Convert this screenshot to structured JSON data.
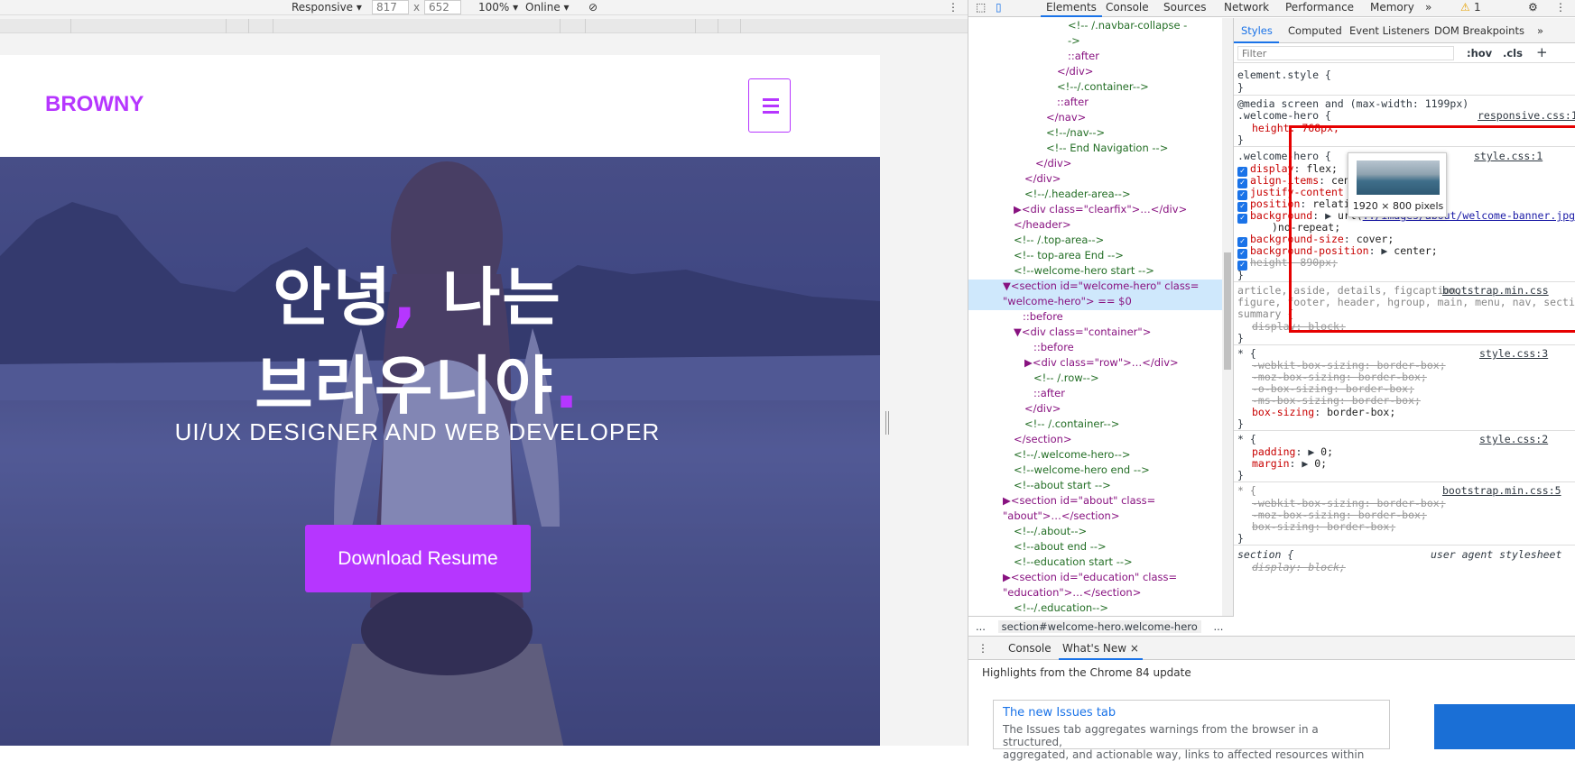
{
  "device_toolbar": {
    "device": "Responsive",
    "width": "817",
    "times": "x",
    "height": "652",
    "zoom": "100%",
    "network": "Online"
  },
  "site": {
    "brand": "BROWNY",
    "hero_line1_a": "안녕",
    "hero_line1_comma": ",",
    "hero_line1_b": " 나는",
    "hero_line2_a": "브라우니야",
    "hero_line2_dot": ".",
    "subtitle": "UI/UX DESIGNER AND WEB DEVELOPER",
    "button": "Download Resume",
    "accent_color": "#b636ff"
  },
  "devtools": {
    "tabs": [
      "Elements",
      "Console",
      "Sources",
      "Network",
      "Performance",
      "Memory"
    ],
    "more_tabs": "»",
    "warning_count": "1",
    "elements_lines": [
      {
        "t": "<!-- /.navbar-collapse -",
        "cls": "cm"
      },
      {
        "t": "->",
        "cls": "cm"
      },
      {
        "t": "::after",
        "cls": "ps"
      },
      {
        "t": "</div>",
        "cls": "tg"
      },
      {
        "t": "<!--/.container-->",
        "cls": "cm"
      },
      {
        "t": "::after",
        "cls": "ps"
      },
      {
        "t": "</nav>",
        "cls": "tg"
      },
      {
        "t": "<!--/nav-->",
        "cls": "cm"
      },
      {
        "t": "<!-- End Navigation -->",
        "cls": "cm"
      },
      {
        "t": "</div>",
        "cls": "tg"
      },
      {
        "t": "</div>",
        "cls": "tg"
      },
      {
        "t": "<!--/.header-area-->",
        "cls": "cm"
      },
      {
        "t": "▶<div class=\"clearfix\">…</div>",
        "cls": "tg"
      },
      {
        "t": "</header>",
        "cls": "tg"
      },
      {
        "t": "<!-- /.top-area-->",
        "cls": "cm"
      },
      {
        "t": "<!-- top-area End -->",
        "cls": "cm"
      },
      {
        "t": "<!--welcome-hero start -->",
        "cls": "cm"
      },
      {
        "t": "▼<section id=\"welcome-hero\" class=",
        "cls": "tg"
      },
      {
        "t": "\"welcome-hero\"> == $0",
        "cls": "tg"
      },
      {
        "t": "::before",
        "cls": "ps"
      },
      {
        "t": "▼<div class=\"container\">",
        "cls": "tg"
      },
      {
        "t": "::before",
        "cls": "ps"
      },
      {
        "t": "▶<div class=\"row\">…</div>",
        "cls": "tg"
      },
      {
        "t": "<!-- /.row-->",
        "cls": "cm"
      },
      {
        "t": "::after",
        "cls": "ps"
      },
      {
        "t": "</div>",
        "cls": "tg"
      },
      {
        "t": "<!-- /.container-->",
        "cls": "cm"
      },
      {
        "t": "</section>",
        "cls": "tg"
      },
      {
        "t": "<!--/.welcome-hero-->",
        "cls": "cm"
      },
      {
        "t": "<!--welcome-hero end -->",
        "cls": "cm"
      },
      {
        "t": "<!--about start -->",
        "cls": "cm"
      },
      {
        "t": "▶<section id=\"about\" class=",
        "cls": "tg"
      },
      {
        "t": "\"about\">…</section>",
        "cls": "tg"
      },
      {
        "t": "<!--/.about-->",
        "cls": "cm"
      },
      {
        "t": "<!--about end -->",
        "cls": "cm"
      },
      {
        "t": "<!--education start -->",
        "cls": "cm"
      },
      {
        "t": "▶<section id=\"education\" class=",
        "cls": "tg"
      },
      {
        "t": "\"education\">…</section>",
        "cls": "tg"
      },
      {
        "t": "<!--/.education-->",
        "cls": "cm"
      }
    ],
    "breadcrumb": "section#welcome-hero.welcome-hero",
    "breadcrumb_dots": "...",
    "styles_tabs": [
      "Styles",
      "Computed",
      "Event Listeners",
      "DOM Breakpoints"
    ],
    "filter_placeholder": "Filter",
    "hov": ":hov",
    "cls": ".cls",
    "plus": "+",
    "rules": {
      "element_style": "element.style {",
      "media": "@media screen and (max-width: 1199px)",
      "media_sel": ".welcome-hero {",
      "media_src": "responsive.css:1",
      "media_height": "height: 768px;",
      "main_sel": ".welcome-hero {",
      "main_src": "style.css:1",
      "p_display": "display",
      "v_display": "flex;",
      "p_align": "align-items",
      "v_align": "cen",
      "p_justify": "justify-content",
      "p_position": "position",
      "v_position": "relative;",
      "p_background": "background",
      "v_background_a": "url(",
      "v_background_link": "../images/about/welcome-banner.jpg",
      "v_background_b": ")no-repeat;",
      "p_bgsize": "background-size",
      "v_bgsize": "cover;",
      "p_bgpos": "background-position",
      "v_bgpos": "center;",
      "p_height": "height",
      "v_height": "890px;",
      "article_sel": "article, aside, details, figcaption,",
      "article_sel2": "figure, footer, header, hgroup, main, menu, nav, section,",
      "article_src": "bootstrap.min.css",
      "summary_sel": "summary {",
      "summary_prop": "display: block;",
      "star1_src": "style.css:3",
      "webkit_bs": "-webkit-box-sizing: border-box;",
      "moz_bs": "-moz-box-sizing: border-box;",
      "o_bs": "-o-box-sizing: border-box;",
      "ms_bs": "-ms-box-sizing: border-box;",
      "bs_prop": "box-sizing",
      "bs_val": "border-box;",
      "star2_src": "style.css:2",
      "padding_prop": "padding",
      "padding_val": "0;",
      "margin_prop": "margin",
      "margin_val": "0;",
      "star3_src": "bootstrap.min.css:5",
      "bs_strike": "box-sizing: border-box;",
      "section_sel": "section {",
      "section_src": "user agent stylesheet",
      "section_prop": "display: block;",
      "star_sel": "* {",
      "close": "}"
    },
    "tooltip": "1920 × 800 pixels",
    "drawer_tabs": [
      "Console",
      "What's New"
    ],
    "drawer_close": "×",
    "drawer_highlights": "Highlights from the Chrome 84 update",
    "card_title": "The new Issues tab",
    "card_body1": "The Issues tab aggregates warnings from the browser in a structured,",
    "card_body2": "aggregated, and actionable way, links to affected resources within"
  }
}
